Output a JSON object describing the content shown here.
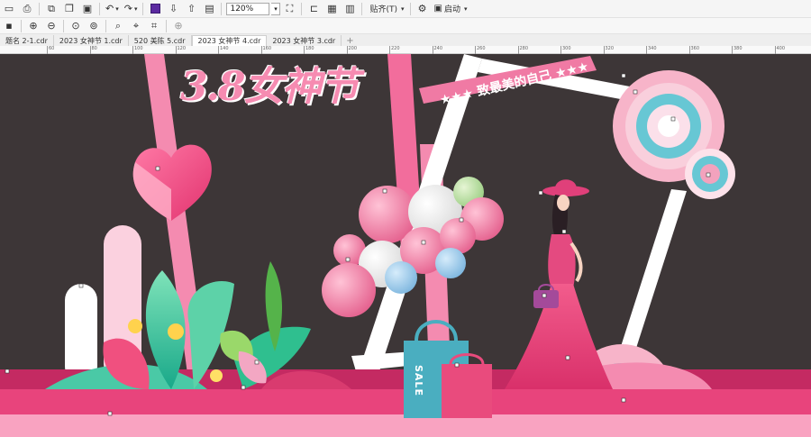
{
  "toolbar": {
    "zoom_value": "120%",
    "snap_label": "贴齐(T)",
    "launch_label": "启动"
  },
  "tabs": [
    {
      "label": "题名 2-1.cdr",
      "active": false
    },
    {
      "label": "2023 女神节 1.cdr",
      "active": false
    },
    {
      "label": "520 美陈 5.cdr",
      "active": false
    },
    {
      "label": "2023 女神节 4.cdr",
      "active": true
    },
    {
      "label": "2023 女神节 3.cdr",
      "active": false
    }
  ],
  "ruler": {
    "labels": [
      "60",
      "80",
      "100",
      "120",
      "140",
      "160",
      "180",
      "200",
      "220",
      "240",
      "260",
      "280",
      "300",
      "320",
      "340",
      "360",
      "380",
      "400",
      "420"
    ]
  },
  "artwork": {
    "title": "3.8女神节",
    "ribbon": "★★★ 致最美的自己 ★★★",
    "bag_text": "SALE"
  },
  "colors": {
    "canvas_bg": "#3d3637",
    "accent_pink": "#e8447c",
    "light_pink": "#f68bb1"
  }
}
